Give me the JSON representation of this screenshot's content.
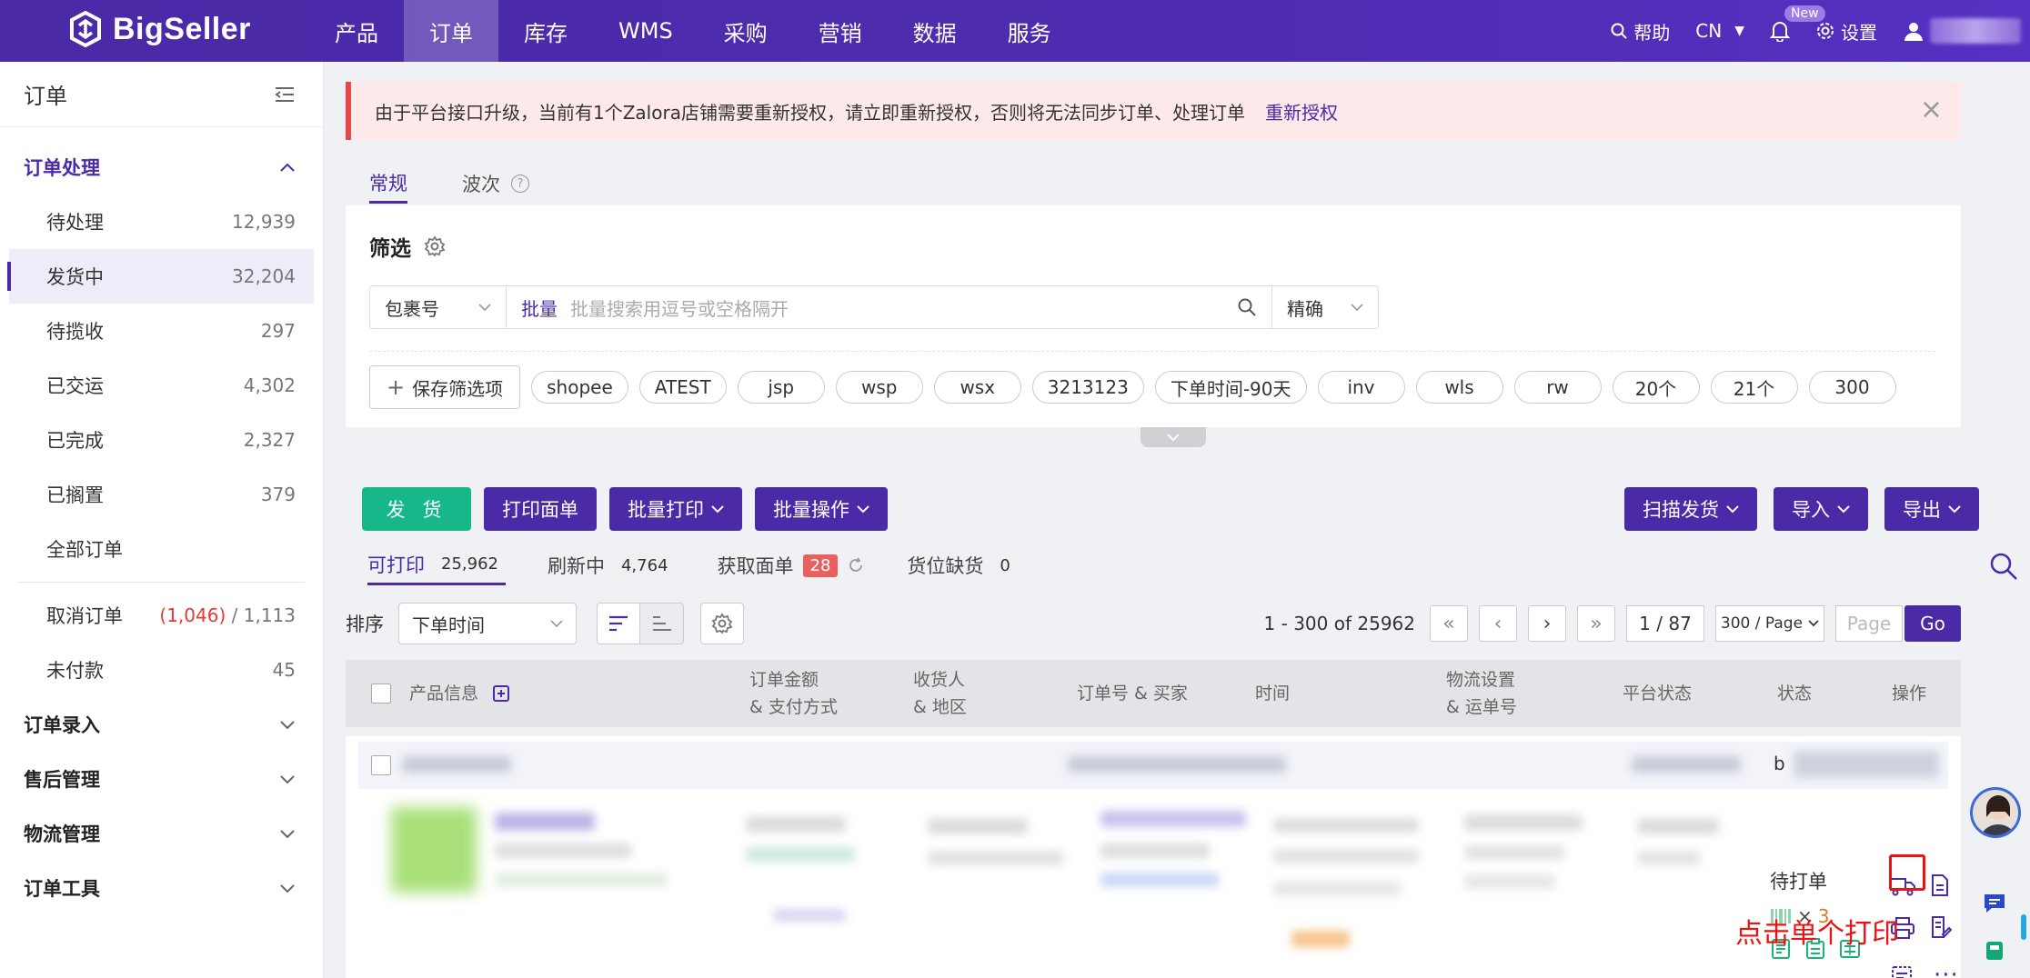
{
  "brand": {
    "name": "BigSeller",
    "accent": "#4a2aa6",
    "success": "#16b889",
    "danger": "#e5484d"
  },
  "nav": {
    "items": [
      "产品",
      "订单",
      "库存",
      "WMS",
      "采购",
      "营销",
      "数据",
      "服务"
    ],
    "active_index": 1,
    "help": "帮助",
    "lang": "CN",
    "new_badge": "New",
    "settings": "设置"
  },
  "sidebar": {
    "title": "订单",
    "group_order": "订单处理",
    "items": [
      {
        "label": "待处理",
        "count": "12,939"
      },
      {
        "label": "发货中",
        "count": "32,204"
      },
      {
        "label": "待揽收",
        "count": "297"
      },
      {
        "label": "已交运",
        "count": "4,302"
      },
      {
        "label": "已完成",
        "count": "2,327"
      },
      {
        "label": "已搁置",
        "count": "379"
      },
      {
        "label": "全部订单",
        "count": ""
      }
    ],
    "cancel": {
      "label": "取消订单",
      "red": "(1,046)",
      "sep": " / ",
      "total": "1,113"
    },
    "unpaid": {
      "label": "未付款",
      "count": "45"
    },
    "groups": [
      "订单录入",
      "售后管理",
      "物流管理",
      "订单工具"
    ]
  },
  "alert": {
    "text": "由于平台接口升级，当前有1个Zalora店铺需要重新授权，请立即重新授权，否则将无法同步订单、处理订单",
    "link": "重新授权"
  },
  "tabs": {
    "normal": "常规",
    "wave": "波次"
  },
  "filter": {
    "title": "筛选",
    "field_select": "包裹号",
    "batch_label": "批量",
    "placeholder": "批量搜索用逗号或空格隔开",
    "match_select": "精确",
    "save_label": "保存筛选项",
    "chips": [
      "shopee",
      "ATEST",
      "jsp",
      "wsp",
      "wsx",
      "3213123",
      "下单时间-90天",
      "inv",
      "wls",
      "rw",
      "20个",
      "21个",
      "300"
    ]
  },
  "actions": {
    "ship": "发 货",
    "print_label": "打印面单",
    "batch_print": "批量打印",
    "batch_ops": "批量操作",
    "scan_ship": "扫描发货",
    "import": "导入",
    "export": "导出"
  },
  "subtabs": [
    {
      "label": "可打印",
      "count": "25,962"
    },
    {
      "label": "刷新中",
      "count": "4,764"
    },
    {
      "label": "获取面单",
      "count": "28"
    },
    {
      "label": "货位缺货",
      "count": "0"
    }
  ],
  "sort": {
    "label": "排序",
    "value": "下单时间"
  },
  "pager": {
    "range": "1 - 300 of 25962",
    "page": "1 / 87",
    "per_page": "300 / Page",
    "page_placeholder": "Page",
    "go": "Go"
  },
  "table": {
    "headers": {
      "product": "产品信息",
      "amount": [
        "订单金额",
        "& 支付方式"
      ],
      "receiver": [
        "收货人",
        "& 地区"
      ],
      "order": "订单号 & 买家",
      "time": "时间",
      "logistics": [
        "物流设置",
        "& 运单号"
      ],
      "platform_status": "平台状态",
      "status": "状态",
      "ops": "操作"
    },
    "row_status": "待打单",
    "row_letter": "b",
    "qty_prefix": "×",
    "qty": "3"
  },
  "annotation": "点击单个打印"
}
